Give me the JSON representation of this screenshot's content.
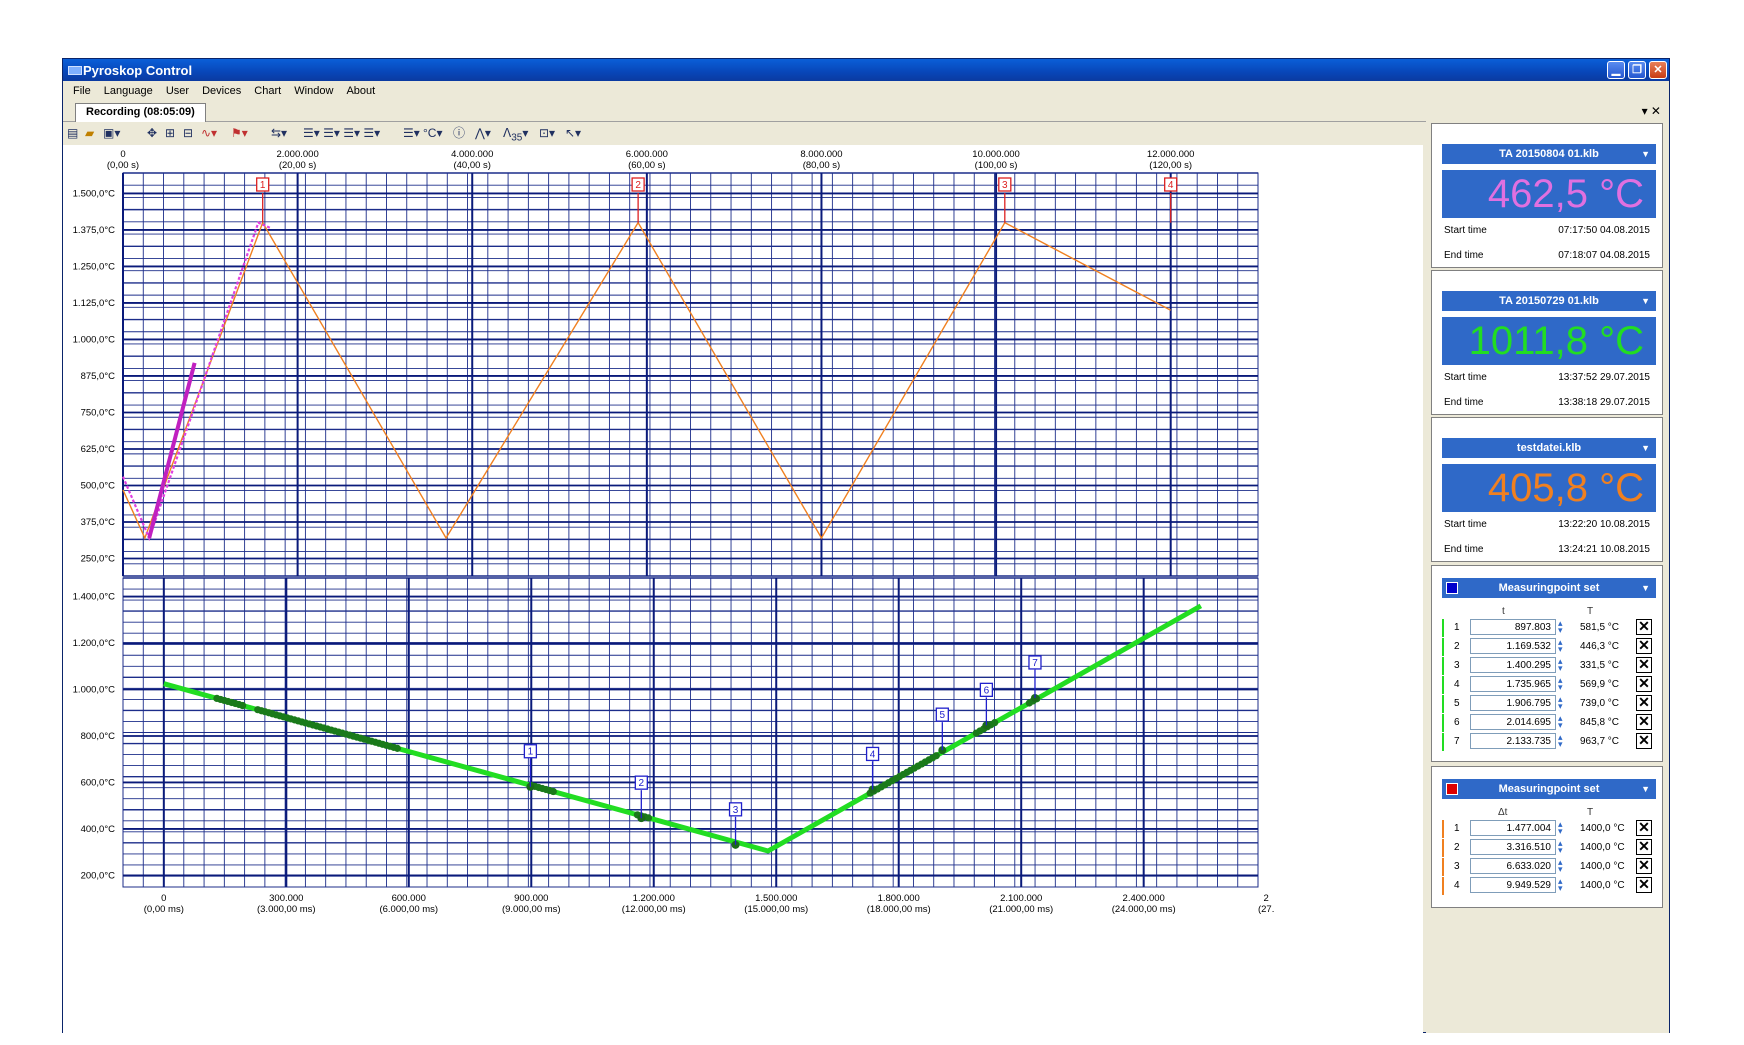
{
  "window": {
    "title": "Pyroskop Control",
    "buttons": [
      "minimize",
      "restore",
      "close"
    ]
  },
  "menu": [
    "File",
    "Language",
    "User",
    "Devices",
    "Chart",
    "Window",
    "About"
  ],
  "tab": {
    "label": "Recording (08:05:09)",
    "controls": "▾ ✕"
  },
  "toolbar_icons": [
    "new-icon",
    "open-icon",
    "export-icon",
    "move-icon",
    "zoom-icon",
    "fit-icon",
    "curve-icon",
    "marker-icon",
    "axis-icon",
    "line-style-icon",
    "unit-icon",
    "info-icon",
    "peak-icon",
    "filter-icon",
    "grid-icon",
    "cursor-icon"
  ],
  "toolbar": {
    "unit": "°C",
    "filter": "35"
  },
  "chart_top": {
    "x_ticks_top": [
      "0",
      "2.000.000",
      "4.000.000",
      "6.000.000",
      "8.000.000",
      "10.000.000",
      "12.000.000"
    ],
    "x_ticks_bottom": [
      "(0,00 s)",
      "(20,00 s)",
      "(40,00 s)",
      "(60,00 s)",
      "(80,00 s)",
      "(100,00 s)",
      "(120,00 s)"
    ],
    "y_ticks": [
      "1.500,0°C",
      "1.375,0°C",
      "1.250,0°C",
      "1.125,0°C",
      "1.000,0°C",
      "875,0°C",
      "750,0°C",
      "625,0°C",
      "500,0°C",
      "375,0°C",
      "250,0°C"
    ],
    "markers": [
      "1",
      "2",
      "3",
      "4"
    ]
  },
  "chart_bottom": {
    "x_ticks_top": [
      "0",
      "300.000",
      "600.000",
      "900.000",
      "1.200.000",
      "1.500.000",
      "1.800.000",
      "2.100.000",
      "2.400.000",
      "2"
    ],
    "x_ticks_bottom": [
      "(0,00 ms)",
      "(3.000,00 ms)",
      "(6.000,00 ms)",
      "(9.000,00 ms)",
      "(12.000,00 ms)",
      "(15.000,00 ms)",
      "(18.000,00 ms)",
      "(21.000,00 ms)",
      "(24.000,00 ms)",
      "(27."
    ],
    "y_ticks": [
      "1.400,0°C",
      "1.200,0°C",
      "1.000,0°C",
      "800,0°C",
      "600,0°C",
      "400,0°C",
      "200,0°C"
    ],
    "markers": [
      "1",
      "2",
      "3",
      "4",
      "5",
      "6",
      "7"
    ]
  },
  "chart_data": [
    {
      "type": "line",
      "xlabel": "",
      "ylabel": "",
      "xlim": [
        0,
        13000000
      ],
      "ylim": [
        190,
        1570
      ],
      "series": [
        {
          "color": "#f08020",
          "points": [
            [
              0,
              485
            ],
            [
              250000,
              320
            ],
            [
              1600000,
              1400
            ],
            [
              3700000,
              320
            ],
            [
              5900000,
              1400
            ],
            [
              8000000,
              320
            ],
            [
              10100000,
              1400
            ],
            [
              12000000,
              1100
            ]
          ]
        },
        {
          "color": "#e040e0",
          "points": [
            [
              0,
              530
            ],
            [
              300000,
              320
            ],
            [
              1550000,
              1400
            ],
            [
              1700000,
              1380
            ]
          ]
        }
      ],
      "marker_x": [
        1600000,
        5900000,
        10100000,
        12000000
      ]
    },
    {
      "type": "line",
      "xlabel": "",
      "ylabel": "",
      "xlim": [
        -100000,
        2680000
      ],
      "ylim": [
        150,
        1480
      ],
      "series": [
        {
          "color": "#22dd22",
          "points": [
            [
              0,
              1025
            ],
            [
              1480000,
              305
            ],
            [
              2540000,
              1360
            ]
          ]
        }
      ],
      "marker_x": [
        897803,
        1169532,
        1400295,
        1735965,
        1906795,
        2014695,
        2133735
      ]
    }
  ],
  "files": [
    {
      "name": "TA 20150804 01.klb",
      "value": "462,5 °C",
      "color": "#e070e0",
      "start_label": "Start time",
      "start": "07:17:50 04.08.2015",
      "end_label": "End time",
      "end": "07:18:07 04.08.2015"
    },
    {
      "name": "TA 20150729 01.klb",
      "value": "1011,8 °C",
      "color": "#22dd22",
      "start_label": "Start time",
      "start": "13:37:52 29.07.2015",
      "end_label": "End time",
      "end": "13:38:18 29.07.2015"
    },
    {
      "name": "testdatei.klb",
      "value": "405,8 °C",
      "color": "#f08020",
      "start_label": "Start time",
      "start": "13:22:20 10.08.2015",
      "end_label": "End time",
      "end": "13:24:21 10.08.2015"
    }
  ],
  "msets": [
    {
      "title": "Measuringpoint set",
      "square": "#0000cc",
      "col1": "t",
      "col2": "T",
      "bar": "#22dd22",
      "rows": [
        [
          "1",
          "897.803",
          "581,5 °C"
        ],
        [
          "2",
          "1.169.532",
          "446,3 °C"
        ],
        [
          "3",
          "1.400.295",
          "331,5 °C"
        ],
        [
          "4",
          "1.735.965",
          "569,9 °C"
        ],
        [
          "5",
          "1.906.795",
          "739,0 °C"
        ],
        [
          "6",
          "2.014.695",
          "845,8 °C"
        ],
        [
          "7",
          "2.133.735",
          "963,7 °C"
        ]
      ]
    },
    {
      "title": "Measuringpoint set",
      "square": "#dd0000",
      "col1": "Δt",
      "col2": "T",
      "bar": "#f08020",
      "rows": [
        [
          "1",
          "1.477.004",
          "1400,0 °C"
        ],
        [
          "2",
          "3.316.510",
          "1400,0 °C"
        ],
        [
          "3",
          "6.633.020",
          "1400,0 °C"
        ],
        [
          "4",
          "9.949.529",
          "1400,0 °C"
        ]
      ]
    }
  ]
}
